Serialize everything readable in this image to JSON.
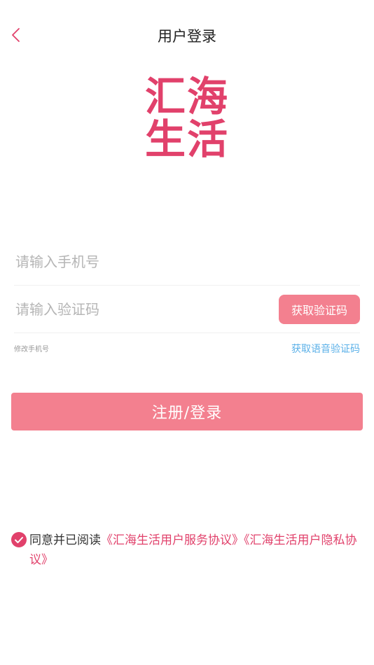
{
  "header": {
    "title": "用户登录",
    "back_icon": "chevron-left-icon"
  },
  "logo": {
    "line1": "汇海",
    "line2": "生活"
  },
  "form": {
    "phone_placeholder": "请输入手机号",
    "phone_value": "",
    "code_placeholder": "请输入验证码",
    "code_value": "",
    "get_code_label": "获取验证码",
    "change_phone_label": "修改手机号",
    "voice_code_label": "获取语音验证码",
    "submit_label": "注册/登录"
  },
  "agreement": {
    "checked": true,
    "prefix": "同意并已阅读",
    "service_link": "《汇海生活用户服务协议》",
    "privacy_link": "《汇海生活用户隐私协议》"
  },
  "colors": {
    "accent": "#e1416b",
    "button": "#f3808f",
    "link_blue": "#5ab0e8"
  }
}
